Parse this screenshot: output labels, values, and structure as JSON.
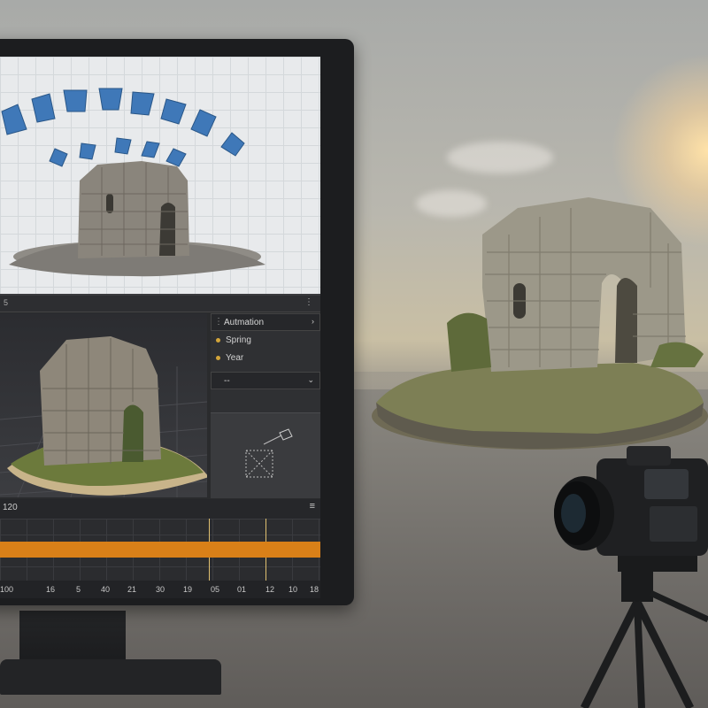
{
  "editor": {
    "panel_number": "5",
    "panel_menu": "⋮",
    "side_panel": {
      "dropdown_label": "Autmation",
      "properties": [
        "Spring",
        "Year"
      ],
      "second_dropdown_label": "--"
    },
    "timeline": {
      "current_frame": "120",
      "menu_icon": "≡",
      "ruler_ticks": [
        "100",
        "16",
        "5",
        "40",
        "21",
        "30",
        "19",
        "05",
        "01",
        "12",
        "10",
        "18"
      ],
      "track_color": "#d98018"
    }
  }
}
